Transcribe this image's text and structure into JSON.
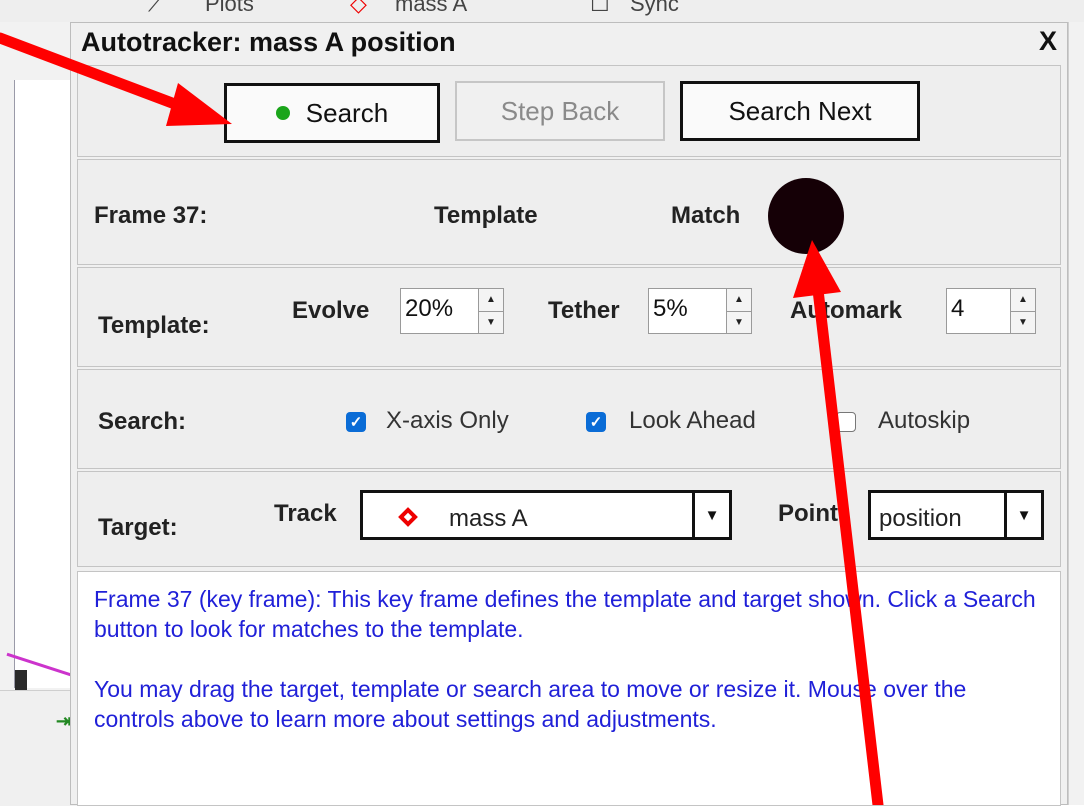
{
  "background": {
    "toolbar": {
      "plots_label": "Plots",
      "track_label": "mass A",
      "sync_label": "Sync"
    }
  },
  "dialog": {
    "title": "Autotracker: mass A position",
    "close_label": "X",
    "buttons": {
      "search_label": "Search",
      "step_back_label": "Step Back",
      "search_next_label": "Search Next"
    },
    "frame_row": {
      "frame_label": "Frame 37:",
      "template_label": "Template",
      "match_label": "Match"
    },
    "template_row": {
      "label": "Template:",
      "evolve_label": "Evolve",
      "evolve_value": "20%",
      "tether_label": "Tether",
      "tether_value": "5%",
      "automark_label": "Automark",
      "automark_value": "4"
    },
    "search_row": {
      "label": "Search:",
      "x_axis_only_label": "X-axis Only",
      "x_axis_only_checked": true,
      "look_ahead_label": "Look Ahead",
      "look_ahead_checked": true,
      "autoskip_label": "Autoskip",
      "autoskip_checked": false
    },
    "target_row": {
      "label": "Target:",
      "track_label": "Track",
      "track_value": "mass A",
      "point_label": "Point",
      "point_value": "position"
    },
    "message": {
      "paragraph1": "Frame 37 (key frame): This key frame defines the template and target shown. Click a Search button to look for matches to the template.",
      "paragraph2": "You may drag the target, template or search area to move or resize it. Mouse over the controls above to learn more about settings and adjustments."
    }
  },
  "colors": {
    "annotation_arrow": "#ff0000",
    "search_status_dot": "#1aa51a",
    "message_text": "#2020d8",
    "track_marker": "#e00000",
    "checkbox_checked": "#0a6cd6"
  }
}
